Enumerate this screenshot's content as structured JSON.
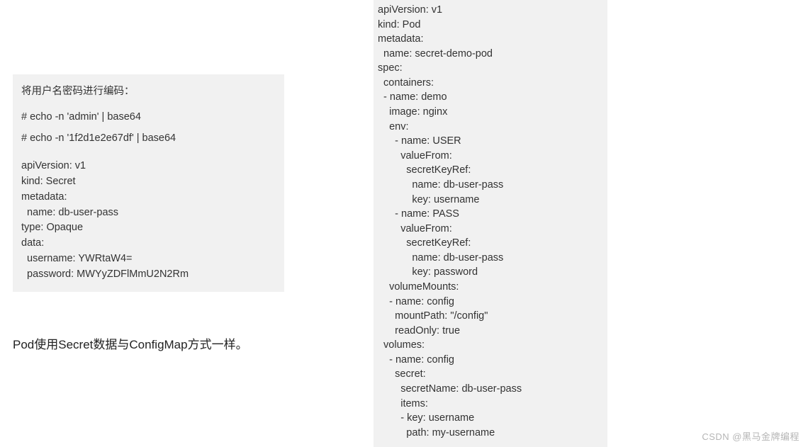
{
  "left": {
    "heading": "将用户名密码进行编码：",
    "cmd1": "# echo -n 'admin' | base64",
    "cmd2": "# echo -n '1f2d1e2e67df' | base64",
    "yaml": "apiVersion: v1\nkind: Secret\nmetadata:\n  name: db-user-pass\ntype: Opaque\ndata:\n  username: YWRtaW4=\n  password: MWYyZDFlMmU2N2Rm"
  },
  "note": "Pod使用Secret数据与ConfigMap方式一样。",
  "right": {
    "yaml": "apiVersion: v1\nkind: Pod\nmetadata:\n  name: secret-demo-pod\nspec:\n  containers:\n  - name: demo\n    image: nginx\n    env:\n      - name: USER\n        valueFrom:\n          secretKeyRef:\n            name: db-user-pass\n            key: username\n      - name: PASS\n        valueFrom:\n          secretKeyRef:\n            name: db-user-pass\n            key: password\n    volumeMounts:\n    - name: config\n      mountPath: \"/config\"\n      readOnly: true\n  volumes:\n    - name: config\n      secret:\n        secretName: db-user-pass\n        items:\n        - key: username\n          path: my-username"
  },
  "watermark": "CSDN @黑马金牌编程"
}
